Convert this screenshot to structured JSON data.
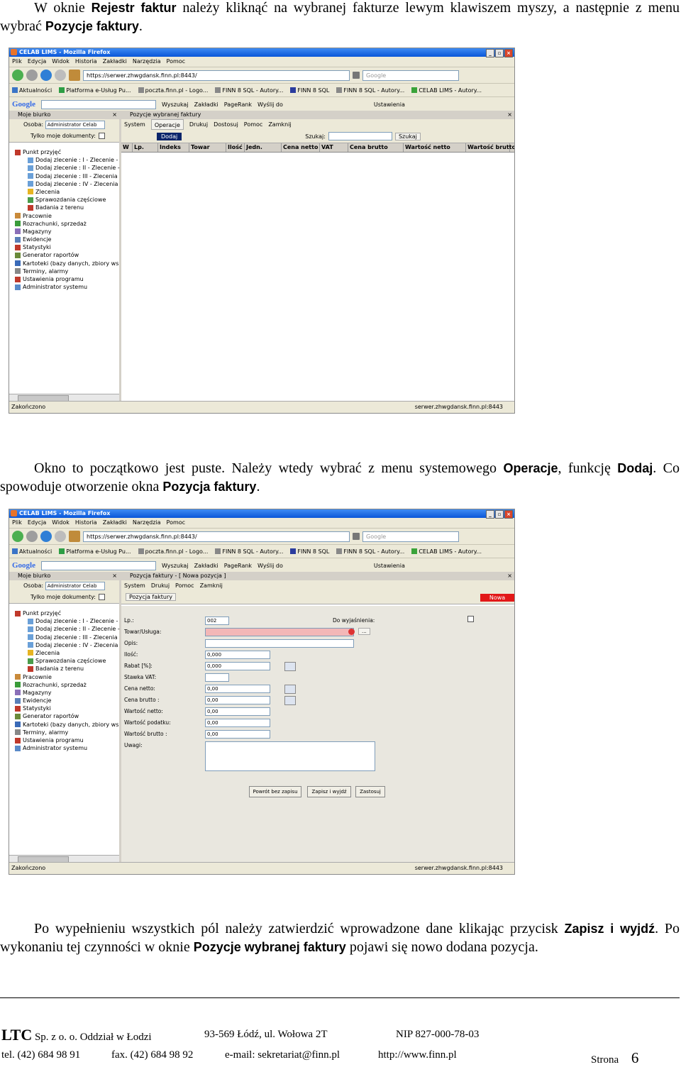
{
  "intro": {
    "text1": "W oknie ",
    "b1": "Rejestr faktur",
    "text2": " należy kliknąć na wybranej fakturze lewym klawiszem myszy, a następnie z menu wybrać ",
    "b2": "Pozycje faktury",
    "text3": "."
  },
  "mid": {
    "text1": "Okno to początkowo jest puste. Należy wtedy wybrać z menu systemowego ",
    "b1": "Operacje",
    "text2": ", funkcję ",
    "b2": "Dodaj",
    "text3": ". Co spowoduje otworzenie okna ",
    "b3": "Pozycja faktury",
    "text4": "."
  },
  "end": {
    "text1": "Po wypełnieniu wszystkich pól należy zatwierdzić wprowadzone dane klikając przycisk ",
    "b1": "Zapisz i wyjdź",
    "text2": ". Po wykonaniu tej czynności w oknie ",
    "b2": "Pozycje wybranej faktury",
    "text3": " pojawi się nowo dodana pozycja."
  },
  "browser": {
    "title": "CELAB LIMS - Mozilla Firefox",
    "menu": [
      "Plik",
      "Edycja",
      "Widok",
      "Historia",
      "Zakładki",
      "Narzędzia",
      "Pomoc"
    ],
    "url": "https://serwer.zhwgdansk.finn.pl:8443/",
    "search_placeholder": "Google",
    "bookmarks": [
      "Aktualności",
      "Platforma e-Usług Pu...",
      "poczta.finn.pl - Logo...",
      "FINN 8 SQL - Autory...",
      "FINN 8 SQL",
      "FINN 8 SQL - Autory...",
      "CELAB LIMS - Autory..."
    ],
    "google_logo": "Google",
    "google_items": [
      "Wyszukaj",
      "Zakładki",
      "PageRank",
      "Wyślij do",
      "Ustawienia"
    ],
    "status_left": "Zakończono",
    "status_right": "serwer.zhwgdansk.finn.pl:8443"
  },
  "left_panel": {
    "title": "Moje biurko",
    "user_label": "Osoba:",
    "user_value": "Administrator Celab",
    "only_mine": "Tylko moje dokumenty:",
    "tree": [
      "Punkt przyjęć",
      "Dodaj zlecenie : I - Zlecenie -",
      "Dodaj zlecenie : II - Zlecenie -",
      "Dodaj zlecenie : III - Zlecenia",
      "Dodaj zlecenie : IV - Zlecenia",
      "Zlecenia",
      "Sprawozdania częściowe",
      "Badania z terenu",
      "Pracownie",
      "Rozrachunki, sprzedaż",
      "Magazyny",
      "Ewidencje",
      "Statystyki",
      "Generator raportów",
      "Kartoteki (bazy danych, zbiory ws",
      "Terminy, alarmy",
      "Ustawienia programu",
      "Administrator systemu"
    ]
  },
  "shot1": {
    "window_title": "Pozycje wybranej faktury",
    "menu": [
      "System",
      "Operacje",
      "Drukuj",
      "Dostosuj",
      "Pomoc",
      "Zamknij"
    ],
    "dodaj": "Dodaj",
    "search_label": "Szukaj:",
    "search_button": "Szukaj",
    "columns": [
      "W",
      "Lp.",
      "Indeks",
      "Towar",
      "Ilość",
      "Jedn.",
      "Cena netto",
      "VAT",
      "Cena brutto",
      "Wartość netto",
      "Wartość brutto"
    ]
  },
  "shot2": {
    "window_title": "Pozycja faktury - [ Nowa pozycja ]",
    "menu": [
      "System",
      "Drukuj",
      "Pomoc",
      "Zamknij"
    ],
    "tab": "Pozycja faktury",
    "nowa": "Nowa",
    "fields": {
      "lp_label": "Lp.:",
      "lp_value": "002",
      "towar_label": "Towar/Usługa:",
      "opis_label": "Opis:",
      "ilosc_label": "Ilość:",
      "ilosc_value": "0,000",
      "rabat_label": "Rabat [%]:",
      "rabat_value": "0,000",
      "vat_label": "Stawka VAT:",
      "cn_label": "Cena netto:",
      "cn_value": "0,00",
      "cb_label": "Cena brutto :",
      "cb_value": "0,00",
      "wn_label": "Wartość netto:",
      "wn_value": "0,00",
      "wp_label": "Wartość podatku:",
      "wp_value": "0,00",
      "wb_label": "Wartość brutto :",
      "wb_value": "0,00",
      "uwagi_label": "Uwagi:",
      "dowyj_label": "Do wyjaśnienia:",
      "dots": "..."
    },
    "buttons": [
      "Powrót bez zapisu",
      "Zapisz i wyjdź",
      "Zastosuj"
    ]
  },
  "footer": {
    "company": "LTC",
    "company_rest": "Sp. z o. o. Oddział w Łodzi",
    "address": "93-569 Łódź, ul. Wołowa 2T",
    "nip": "NIP 827-000-78-03",
    "tel": "tel. (42) 684 98 91",
    "fax": "fax. (42) 684 98 92",
    "email": "e-mail:  sekretariat@finn.pl",
    "web": "http://www.finn.pl",
    "page_label": "Strona",
    "page_num": "6"
  }
}
